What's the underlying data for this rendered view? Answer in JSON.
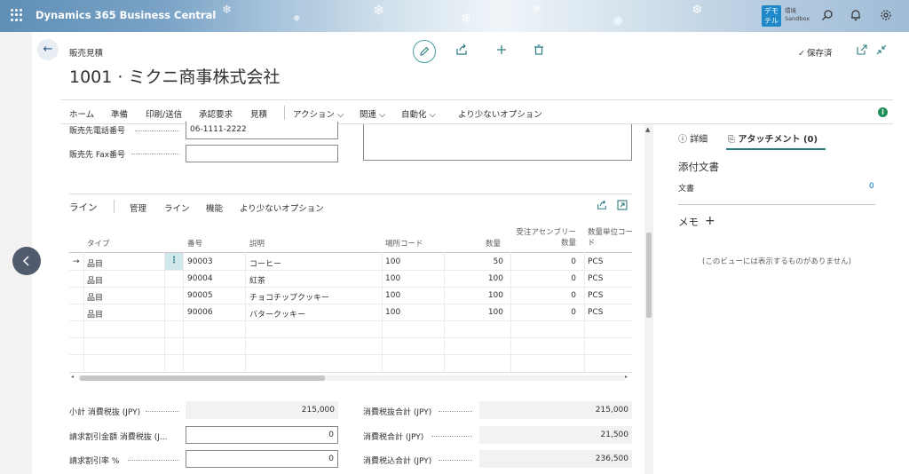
{
  "app": {
    "name": "Dynamics 365 Business Central"
  },
  "environment": {
    "logo_text": "デモ\nテル",
    "line1": "環境",
    "line2": "Sandbox"
  },
  "header": {
    "page_type": "販売見積",
    "title": "1001 · ミクニ商事株式会社",
    "saved_label": "保存済"
  },
  "actions": {
    "items": [
      "ホーム",
      "準備",
      "印刷/送信",
      "承認要求",
      "見積"
    ],
    "menus": [
      "アクション",
      "関連",
      "自動化"
    ],
    "fewer": "より少ないオプション"
  },
  "fields": {
    "phone_label": "販売先電話番号",
    "phone_value": "06-1111-2222",
    "fax_label": "販売先 Fax番号",
    "fax_value": ""
  },
  "lines": {
    "title": "ライン",
    "tabs": [
      "管理",
      "ライン",
      "機能",
      "より少ないオプション"
    ],
    "columns": {
      "type": "タイプ",
      "no": "番号",
      "description": "説明",
      "location": "場所コード",
      "quantity": "数量",
      "assembly_line1": "受注アセンブリー",
      "assembly_line2": "数量",
      "uom_line1": "数量単位コー",
      "uom_line2": "ド"
    },
    "rows": [
      {
        "type": "品目",
        "no": "90003",
        "description": "コーヒー",
        "location": "100",
        "quantity": "50",
        "assembly": "0",
        "uom": "PCS"
      },
      {
        "type": "品目",
        "no": "90004",
        "description": "紅茶",
        "location": "100",
        "quantity": "100",
        "assembly": "0",
        "uom": "PCS"
      },
      {
        "type": "品目",
        "no": "90005",
        "description": "チョコチップクッキー",
        "location": "100",
        "quantity": "100",
        "assembly": "0",
        "uom": "PCS"
      },
      {
        "type": "品目",
        "no": "90006",
        "description": "バタークッキー",
        "location": "100",
        "quantity": "100",
        "assembly": "0",
        "uom": "PCS"
      }
    ]
  },
  "totals": {
    "subtotal_label": "小計 消費税抜 (JPY)",
    "subtotal_value": "215,000",
    "inv_discount_amount_label": "請求割引金額 消費税抜 (J...",
    "inv_discount_amount_value": "0",
    "inv_discount_pct_label": "請求割引率 %",
    "inv_discount_pct_value": "0",
    "total_excl_label": "消費税抜合計 (JPY)",
    "total_excl_value": "215,000",
    "tax_label": "消費税合計 (JPY)",
    "tax_value": "21,500",
    "total_incl_label": "消費税込合計 (JPY)",
    "total_incl_value": "236,500"
  },
  "factbox": {
    "tab_details": "詳細",
    "tab_attachments": "アタッチメント (0)",
    "attached_docs": "添付文書",
    "documents_label": "文書",
    "documents_count": "0",
    "notes": "メモ",
    "empty_text": "(このビューには表示するものがありません)"
  }
}
